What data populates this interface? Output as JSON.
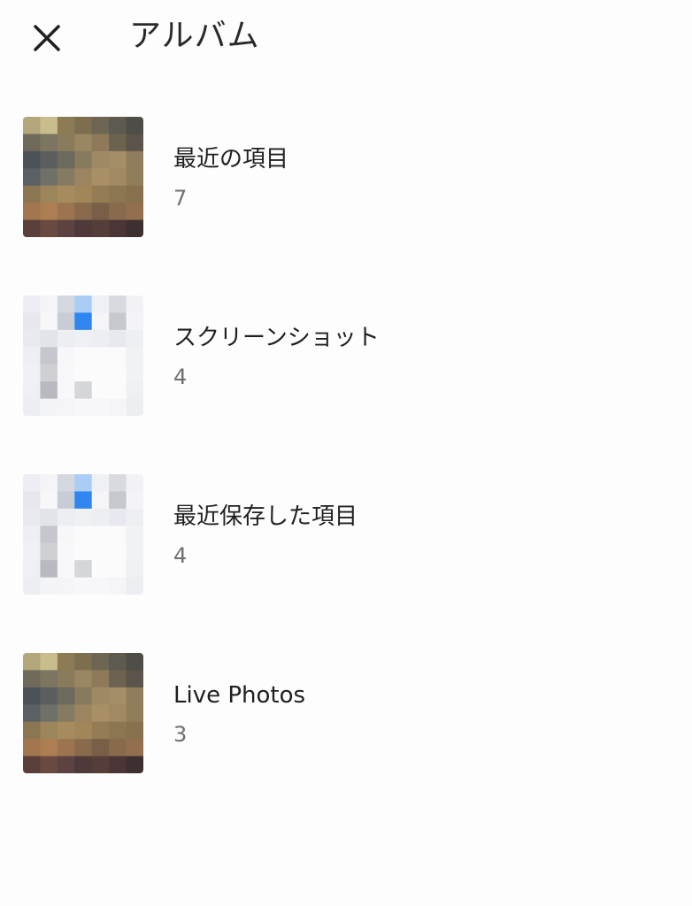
{
  "header": {
    "title": "アルバム",
    "close_icon": "close-icon"
  },
  "albums": [
    {
      "name": "最近の項目",
      "count": "7",
      "thumbnail": "pixelated-photo"
    },
    {
      "name": "スクリーンショット",
      "count": "4",
      "thumbnail": "pixelated-screenshot"
    },
    {
      "name": "最近保存した項目",
      "count": "4",
      "thumbnail": "pixelated-screenshot"
    },
    {
      "name": "Live Photos",
      "count": "3",
      "thumbnail": "pixelated-photo"
    }
  ],
  "colors": {
    "background": "#fdfdfd",
    "text": "#1f1f1f",
    "secondary_text": "#6e6e73",
    "accent_blue": "#2f86f0"
  }
}
